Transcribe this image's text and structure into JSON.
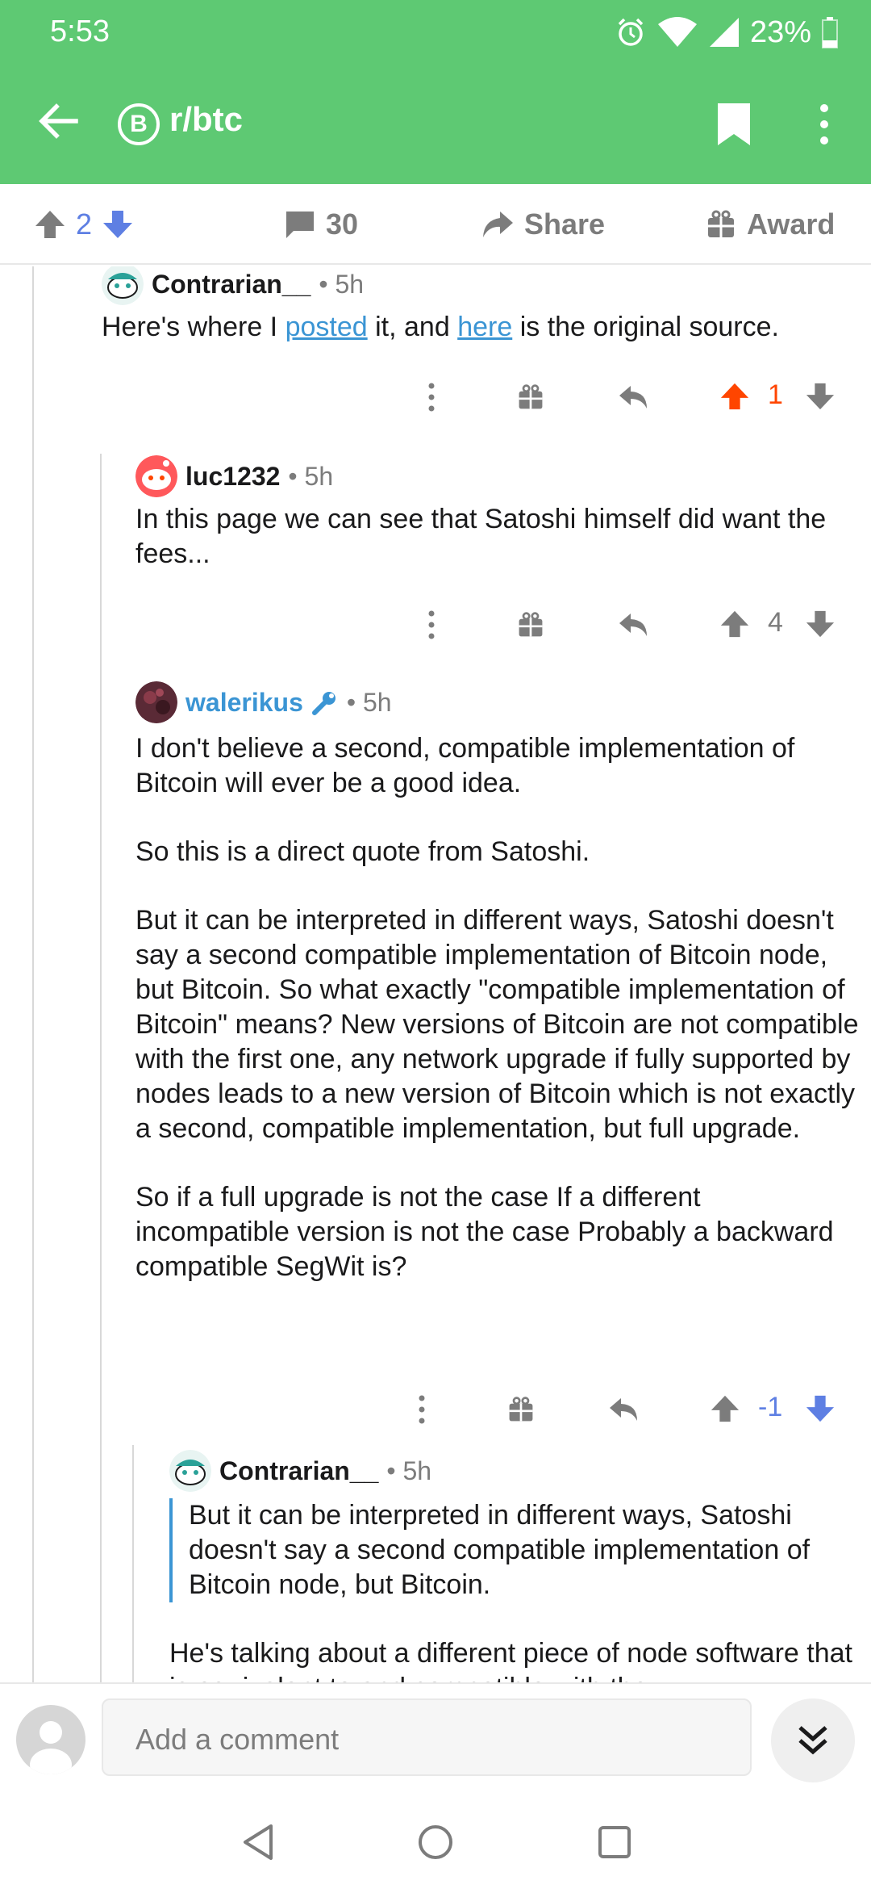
{
  "status": {
    "time": "5:53",
    "battery": "23%"
  },
  "header": {
    "subreddit": "r/btc",
    "sub_icon_letter": "B",
    "bg": "#5ec973"
  },
  "action_bar": {
    "votes": "2",
    "comments": "30",
    "share": "Share",
    "award": "Award"
  },
  "comments": [
    {
      "user": "Contrarian__",
      "time": "5h",
      "body_pre": "Here's where I ",
      "link1": "posted",
      "body_mid": " it, and ",
      "link2": "here",
      "body_post": " is the original source.",
      "votes": "1"
    },
    {
      "user": "luc1232",
      "time": "5h",
      "body": "In this page we can see that Satoshi himself did want the fees...",
      "votes": "4"
    },
    {
      "user": "walerikus",
      "time": "5h",
      "paragraphs": [
        "I don't believe a second, compatible implementation of Bitcoin will ever be a good idea.",
        "So this is a direct quote from Satoshi.",
        "But it can be interpreted in different ways, Satoshi doesn't say a second compatible implementation of Bitcoin node, but Bitcoin. So what exactly \"compatible implementation of Bitcoin\" means? New versions of Bitcoin are not compatible with the first one, any network upgrade if fully supported by nodes leads to a new version of Bitcoin which is not exactly a second, compatible implementation, but full upgrade.",
        "So if a full upgrade is not the case If a different incompatible version is not the case Probably a backward compatible SegWit is?"
      ],
      "votes": "-1"
    },
    {
      "user": "Contrarian__",
      "time": "5h",
      "quote": "But it can be interpreted in different ways, Satoshi doesn't say a second compatible implementation of Bitcoin node, but Bitcoin.",
      "body": "He's talking about a different piece of node software that is equivalent to and compatible with the"
    }
  ],
  "bottom": {
    "placeholder": "Add a comment"
  },
  "colors": {
    "upvote_active": "#ff4500",
    "downvote_active": "#5e7fe3",
    "link": "#3b95d4"
  }
}
